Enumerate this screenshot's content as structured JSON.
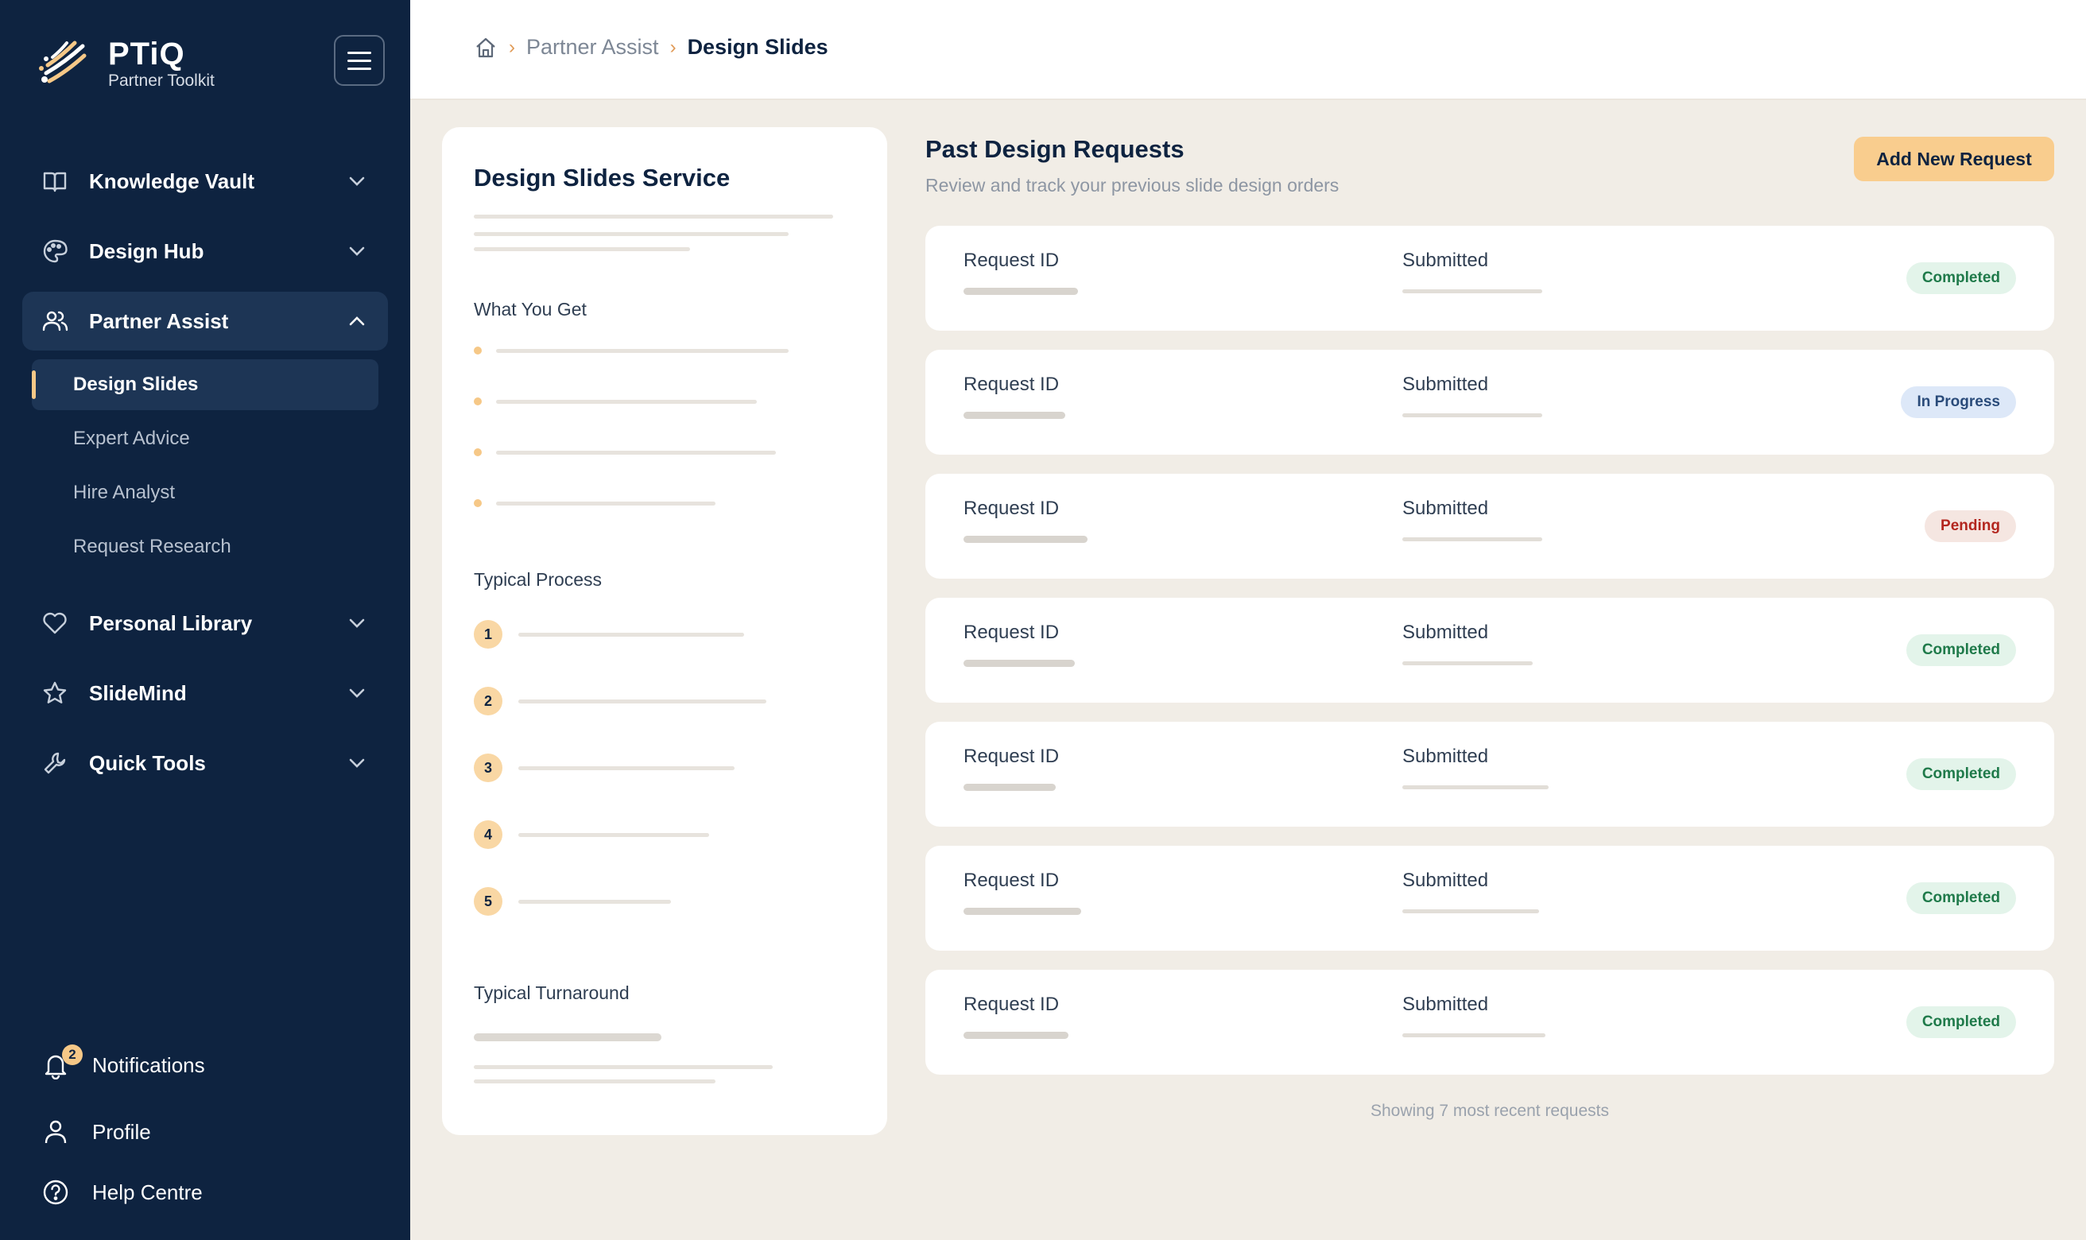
{
  "app": {
    "name": "PTiQ",
    "tagline": "Partner Toolkit"
  },
  "colors": {
    "sidebar_bg": "#0e2340",
    "accent": "#f6c887",
    "page_bg": "#f1ede6"
  },
  "sidebar": {
    "nav": [
      {
        "label": "Knowledge Vault",
        "icon": "book-icon"
      },
      {
        "label": "Design Hub",
        "icon": "palette-icon"
      },
      {
        "label": "Partner Assist",
        "icon": "users-icon"
      },
      {
        "label": "Personal Library",
        "icon": "heart-icon"
      },
      {
        "label": "SlideMind",
        "icon": "star-icon"
      },
      {
        "label": "Quick Tools",
        "icon": "wrench-icon"
      }
    ],
    "partner_assist_sub": [
      {
        "label": "Design Slides",
        "active": true
      },
      {
        "label": "Expert Advice"
      },
      {
        "label": "Hire Analyst"
      },
      {
        "label": "Request Research"
      }
    ],
    "footer": {
      "notifications": "Notifications",
      "notifications_count": "2",
      "profile": "Profile",
      "help": "Help Centre"
    }
  },
  "breadcrumb": {
    "parent": "Partner Assist",
    "current": "Design Slides"
  },
  "service_card": {
    "title": "Design Slides Service",
    "what_you_get": "What You Get",
    "typical_process": "Typical Process",
    "typical_turnaround": "Typical Turnaround",
    "steps": [
      "1",
      "2",
      "3",
      "4",
      "5"
    ]
  },
  "requests": {
    "title": "Past Design Requests",
    "subtitle": "Review and track your previous slide design orders",
    "add_button": "Add New Request",
    "col_id": "Request ID",
    "col_submitted": "Submitted",
    "items": [
      {
        "status": "Completed"
      },
      {
        "status": "In Progress"
      },
      {
        "status": "Pending"
      },
      {
        "status": "Completed"
      },
      {
        "status": "Completed"
      },
      {
        "status": "Completed"
      },
      {
        "status": "Completed"
      }
    ],
    "footnote": "Showing 7 most recent requests"
  }
}
